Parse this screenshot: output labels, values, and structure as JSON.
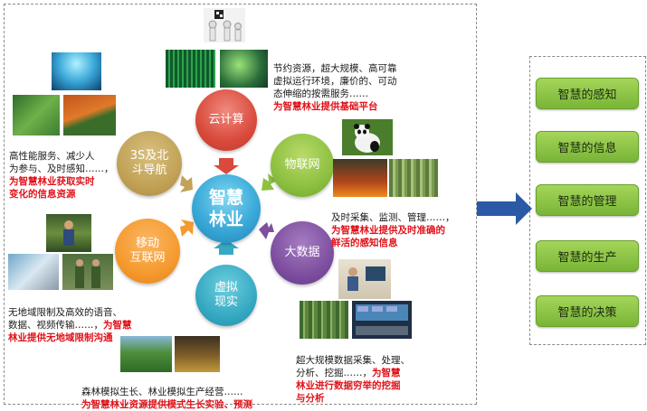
{
  "center": {
    "label": "智慧\n林业"
  },
  "nodes": {
    "cloud": "云计算",
    "iot": "物联网",
    "bigdata": "大数据",
    "virtual": "虚拟\n现实",
    "mobile": "移动\n互联网",
    "gnss": "3S及北\n斗导航"
  },
  "descriptions": {
    "cloud": {
      "text": "节约资源，超大规模、高可靠\n虚拟运行环境，廉价的、可动\n态伸缩的按需服务……",
      "highlight": "为智慧林业提供基础平台"
    },
    "iot": {
      "text": "及时采集、监测、管理……，",
      "highlight": "为智慧林业提供及时准确的\n鲜活的感知信息"
    },
    "bigdata": {
      "text": "超大规模数据采集、处理、\n分析、挖掘……，",
      "highlight": "为智慧\n林业进行数据穷举的挖掘\n与分析"
    },
    "virtual": {
      "text": "森林模拟生长、林业模拟生产经营……",
      "highlight": "为智慧林业资源提供模式生长实验、预测"
    },
    "mobile": {
      "text": "无地域限制及高效的语音、\n数据、视频传输……，",
      "highlight": "为智慧\n林业提供无地域限制沟通"
    },
    "gnss": {
      "text": "高性能服务、减少人\n为参与、及时感知……，",
      "highlight": "为智慧林业获取实时\n变化的信息资源"
    }
  },
  "outcomes": [
    "智慧的感知",
    "智慧的信息",
    "智慧的管理",
    "智慧的生产",
    "智慧的决策"
  ],
  "colors": {
    "accent_red": "#e0121a",
    "arrow_blue": "#2a5aa6",
    "button_green": "#8dc63f"
  }
}
